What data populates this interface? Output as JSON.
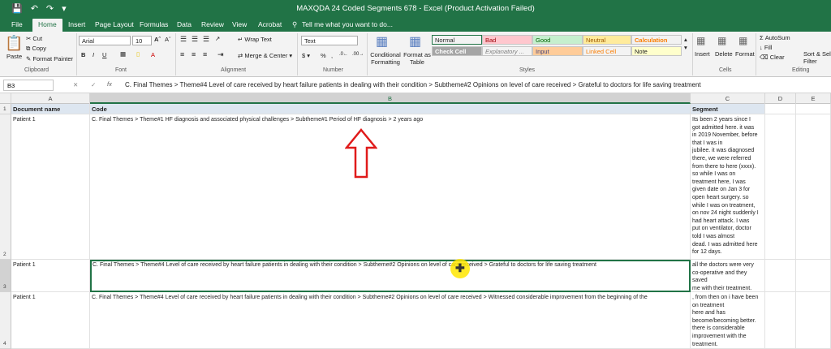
{
  "window": {
    "title": "MAXQDA 24 Coded Segments 678 - Excel (Product Activation Failed)"
  },
  "tabs": [
    "File",
    "Home",
    "Insert",
    "Page Layout",
    "Formulas",
    "Data",
    "Review",
    "View",
    "Acrobat"
  ],
  "tell_me": "Tell me what you want to do...",
  "ribbon": {
    "clipboard": {
      "paste": "Paste",
      "cut": "Cut",
      "copy": "Copy",
      "format_painter": "Format Painter",
      "label": "Clipboard"
    },
    "font": {
      "name": "Arial",
      "size": "10",
      "label": "Font"
    },
    "alignment": {
      "wrap": "Wrap Text",
      "merge": "Merge & Center",
      "label": "Alignment"
    },
    "number": {
      "format": "Text",
      "label": "Number"
    },
    "styles": {
      "conditional": "Conditional Formatting",
      "format_table": "Format as Table",
      "label": "Styles",
      "cells": [
        {
          "name": "Normal",
          "bg": "#ffffff",
          "fg": "#000000"
        },
        {
          "name": "Bad",
          "bg": "#ffc7ce",
          "fg": "#9c0006"
        },
        {
          "name": "Good",
          "bg": "#c6efce",
          "fg": "#006100"
        },
        {
          "name": "Neutral",
          "bg": "#ffeb9c",
          "fg": "#9c5700"
        },
        {
          "name": "Calculation",
          "bg": "#f2f2f2",
          "fg": "#fa7d00"
        },
        {
          "name": "Check Cell",
          "bg": "#a5a5a5",
          "fg": "#ffffff"
        },
        {
          "name": "Explanatory ...",
          "bg": "#ffffff",
          "fg": "#7f7f7f"
        },
        {
          "name": "Input",
          "bg": "#ffcc99",
          "fg": "#3f3f76"
        },
        {
          "name": "Linked Cell",
          "bg": "#ffffff",
          "fg": "#fa7d00"
        },
        {
          "name": "Note",
          "bg": "#ffffcc",
          "fg": "#000000"
        }
      ]
    },
    "cells": {
      "insert": "Insert",
      "delete": "Delete",
      "format": "Format",
      "label": "Cells"
    },
    "editing": {
      "autosum": "AutoSum",
      "fill": "Fill",
      "clear": "Clear",
      "sort": "Sort & Filter",
      "select": "Sel",
      "label": "Editing"
    }
  },
  "formula_bar": {
    "name_box": "B3",
    "content": "C. Final Themes > Theme#4 Level of care received  by heart failure patients in  dealing with their condition > Subtheme#2 Opinions on level of care received > Grateful to doctors for life saving treatment"
  },
  "columns": [
    "A",
    "B",
    "C",
    "D",
    "E"
  ],
  "rows": [
    {
      "num": "1",
      "a": "Document name",
      "b": "Code",
      "c": "Segment"
    },
    {
      "num": "2",
      "a": "Patient 1",
      "b": "C. Final Themes > Theme#1 HF diagnosis and associated physical challenges > Subtheme#1 Period of HF diagnosis > 2 years ago",
      "c": "Its been 2 years since I\ngot admitted here. it was\nin 2019 November, before\nthat I was in\njubilee. it was diagnosed\nthere, we were referred\nfrom there to here (xxxx).\nso while I was on\ntreatment here, I was\ngiven date on Jan 3 for\nopen heart surgery.  so\nwhile I was on treatment,\non nov 24 night suddenly I\nhad heart attack. I was\nput on ventilator, doctor\ntold I was almost\ndead. I was admitted here\nfor 12 days."
    },
    {
      "num": "3",
      "a": "Patient 1",
      "b": "C. Final Themes > Theme#4 Level of care received  by heart failure patients in  dealing with their condition > Subtheme#2 Opinions on level of care received > Grateful to doctors for life saving treatment",
      "c": "all the doctors were very\nco-operative and they\nsaved\nme with their treatment."
    },
    {
      "num": "4",
      "a": "Patient 1",
      "b": "C. Final Themes > Theme#4 Level of care received  by heart failure patients in  dealing with their condition > Subtheme#2 Opinions on level of care received > Witnessed considerable improvement from the beginning of the",
      "c": ", from then on i have been\non treatment\nhere and has\nbecome/becoming better.\nthere is considerable\nimprovement with the\ntreatment."
    }
  ]
}
